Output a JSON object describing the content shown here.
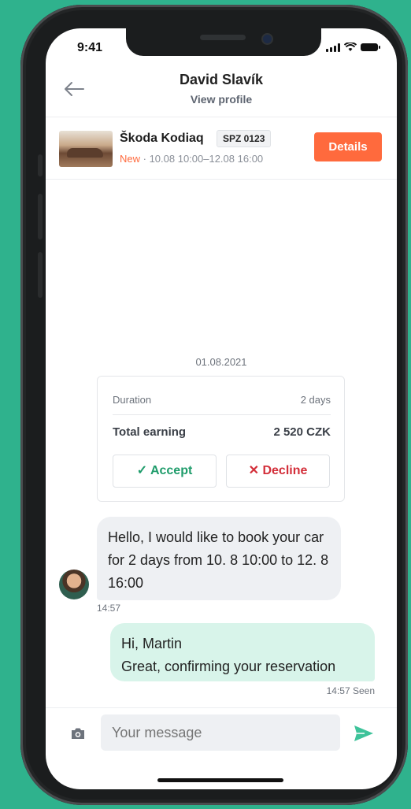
{
  "status": {
    "time": "9:41"
  },
  "header": {
    "title": "David Slavík",
    "subtitle": "View profile"
  },
  "booking": {
    "car": "Škoda Kodiaq",
    "plate": "SPZ 0123",
    "status": "New",
    "dates": " · 10.08 10:00–12.08 16:00",
    "details_label": "Details"
  },
  "request": {
    "date": "01.08.2021",
    "duration_label": "Duration",
    "duration_value": "2 days",
    "total_label": "Total earning",
    "total_value": "2 520 CZK",
    "accept_label": "Accept",
    "decline_label": "Decline"
  },
  "messages": [
    {
      "text": "Hello, I would like to book your car for 2 days from 10. 8 10:00 to 12. 8 16:00",
      "time": "14:57"
    },
    {
      "line1": "Hi, Martin",
      "line2": "Great, confirming your reservation",
      "meta": "14:57 Seen"
    }
  ],
  "composer": {
    "placeholder": "Your message"
  },
  "colors": {
    "accent_orange": "#ff6a3d",
    "accept_green": "#1f9c6b",
    "decline_red": "#d32f3a",
    "bubble_out": "#d8f4ea",
    "background": "#2fb28d"
  }
}
